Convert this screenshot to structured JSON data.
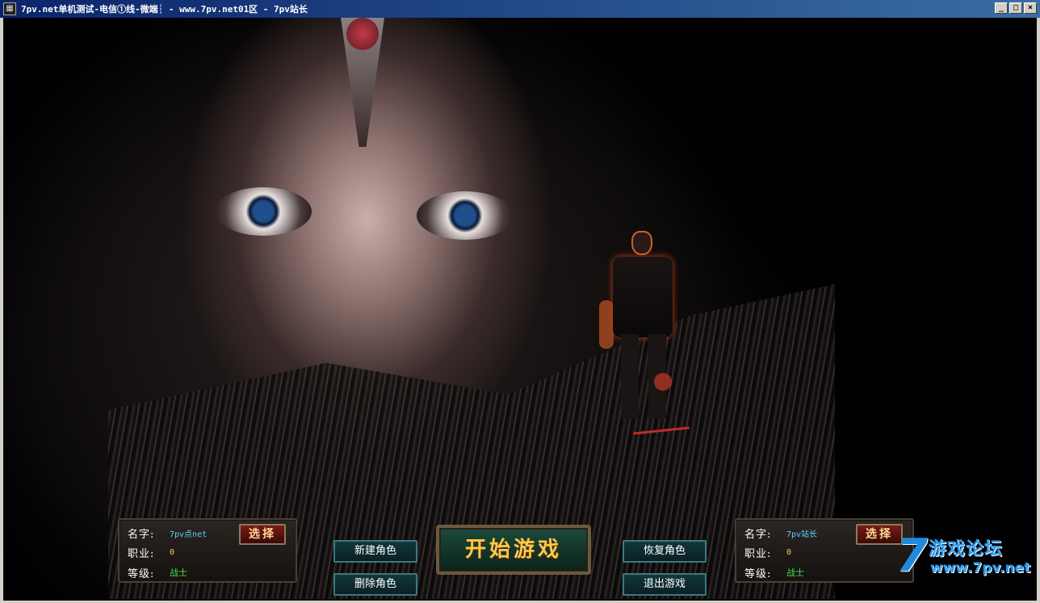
{
  "window": {
    "title": "7pv.net单机测试-电信①线-微端┆ - www.7pv.net01区 - 7pv站长",
    "icon": "app-icon",
    "minimize": "_",
    "maximize": "□",
    "close": "×"
  },
  "left_panel": {
    "name_label": "名字:",
    "name_value": "7pv点net",
    "job_label": "职业:",
    "job_value": "0",
    "level_label": "等级:",
    "level_value": "战士",
    "select_label": "选择"
  },
  "right_panel": {
    "name_label": "名字:",
    "name_value": "7pv站长",
    "job_label": "职业:",
    "job_value": "0",
    "level_label": "等级:",
    "level_value": "战士",
    "select_label": "选择"
  },
  "buttons": {
    "new_role": "新建角色",
    "delete_role": "删除角色",
    "start_game": "开始游戏",
    "restore_role": "恢复角色",
    "exit_game": "退出游戏"
  },
  "watermark": {
    "seven": "7",
    "title": "游戏论坛",
    "url": "www.7pv.net"
  }
}
